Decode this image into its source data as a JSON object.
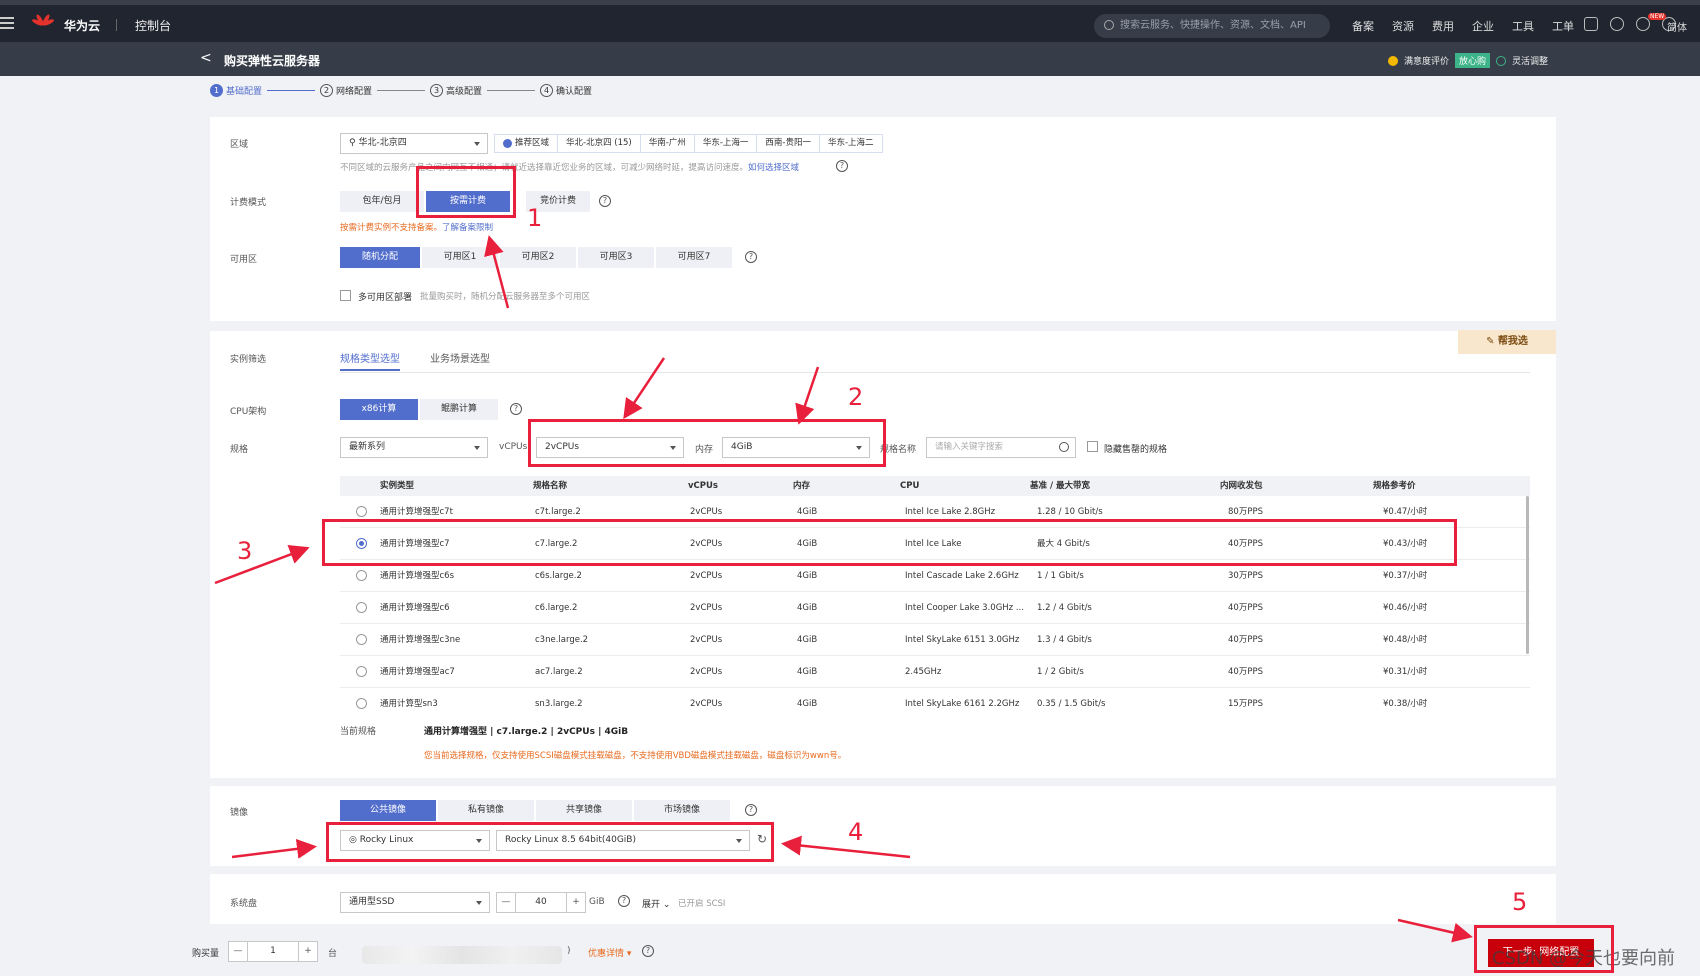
{
  "topbar": {
    "brand": "华为云",
    "console": "控制台",
    "search_placeholder": "搜索云服务、快捷操作、资源、文档、API",
    "links": [
      "备案",
      "资源",
      "费用",
      "企业",
      "工具",
      "工单"
    ],
    "new_badge": "NEW",
    "lang": "简体"
  },
  "subbar": {
    "back": "<",
    "title": "购买弹性云服务器",
    "feedback": "满意度评价",
    "badge": "放心购",
    "flex": "灵活调整"
  },
  "steps": [
    {
      "num": "1",
      "label": "基础配置"
    },
    {
      "num": "2",
      "label": "网络配置"
    },
    {
      "num": "3",
      "label": "高级配置"
    },
    {
      "num": "4",
      "label": "确认配置"
    }
  ],
  "region": {
    "label": "区域",
    "value": "华北-北京四",
    "recommend_label": "推荐区域",
    "options": [
      "华北-北京四 (15)",
      "华南-广州",
      "华东-上海一",
      "西南-贵阳一",
      "华东-上海二"
    ],
    "note": "不同区域的云服务产品之间内网互不相通；请就近选择靠近您业务的区域，可减少网络时延，提高访问速度。",
    "note_link": "如何选择区域"
  },
  "billing": {
    "label": "计费模式",
    "options": [
      "包年/包月",
      "按需计费",
      "竞价计费"
    ],
    "warning": "按需计费实例不支持备案。",
    "warning_link": "了解备案限制"
  },
  "zone": {
    "label": "可用区",
    "options": [
      "随机分配",
      "可用区1",
      "可用区2",
      "可用区3",
      "可用区7"
    ],
    "multi_label": "多可用区部署",
    "multi_note": "批量购买时，随机分配云服务器至多个可用区"
  },
  "instance_filter": {
    "label": "实例筛选",
    "tabs": [
      "规格类型选型",
      "业务场景选型"
    ],
    "helpme": "帮我选"
  },
  "cpu_arch": {
    "label": "CPU架构",
    "options": [
      "x86计算",
      "鲲鹏计算"
    ]
  },
  "spec": {
    "label": "规格",
    "series": "最新系列",
    "vcpus_label": "vCPUs",
    "vcpus": "2vCPUs",
    "mem_label": "内存",
    "mem": "4GiB",
    "name_label": "规格名称",
    "name_placeholder": "请输入关键字搜索",
    "hide_label": "隐藏售罄的规格"
  },
  "table": {
    "headers": [
      "实例类型",
      "规格名称",
      "vCPUs",
      "内存",
      "CPU",
      "基准 / 最大带宽",
      "内网收发包",
      "规格参考价"
    ],
    "rows": [
      {
        "type": "通用计算增强型c7t",
        "name": "c7t.large.2",
        "vcpus": "2vCPUs",
        "mem": "4GiB",
        "cpu": "Intel Ice Lake 2.8GHz",
        "bw": "1.28 / 10 Gbit/s",
        "pps": "80万PPS",
        "price": "¥0.47/小时"
      },
      {
        "type": "通用计算增强型c7",
        "name": "c7.large.2",
        "vcpus": "2vCPUs",
        "mem": "4GiB",
        "cpu": "Intel Ice Lake",
        "bw": "最大 4 Gbit/s",
        "pps": "40万PPS",
        "price": "¥0.43/小时"
      },
      {
        "type": "通用计算增强型c6s",
        "name": "c6s.large.2",
        "vcpus": "2vCPUs",
        "mem": "4GiB",
        "cpu": "Intel Cascade Lake 2.6GHz",
        "bw": "1 / 1 Gbit/s",
        "pps": "30万PPS",
        "price": "¥0.37/小时"
      },
      {
        "type": "通用计算增强型c6",
        "name": "c6.large.2",
        "vcpus": "2vCPUs",
        "mem": "4GiB",
        "cpu": "Intel Cooper Lake 3.0GHz ...",
        "bw": "1.2 / 4 Gbit/s",
        "pps": "40万PPS",
        "price": "¥0.46/小时"
      },
      {
        "type": "通用计算增强型c3ne",
        "name": "c3ne.large.2",
        "vcpus": "2vCPUs",
        "mem": "4GiB",
        "cpu": "Intel SkyLake 6151 3.0GHz",
        "bw": "1.3 / 4 Gbit/s",
        "pps": "40万PPS",
        "price": "¥0.48/小时"
      },
      {
        "type": "通用计算增强型ac7",
        "name": "ac7.large.2",
        "vcpus": "2vCPUs",
        "mem": "4GiB",
        "cpu": "2.45GHz",
        "bw": "1 / 2 Gbit/s",
        "pps": "40万PPS",
        "price": "¥0.31/小时"
      },
      {
        "type": "通用计算型sn3",
        "name": "sn3.large.2",
        "vcpus": "2vCPUs",
        "mem": "4GiB",
        "cpu": "Intel SkyLake 6161 2.2GHz",
        "bw": "0.35 / 1.5 Gbit/s",
        "pps": "15万PPS",
        "price": "¥0.38/小时"
      }
    ]
  },
  "current": {
    "label": "当前规格",
    "value": "通用计算增强型 | c7.large.2 | 2vCPUs | 4GiB",
    "warning": "您当前选择规格，仅支持使用SCSI磁盘模式挂载磁盘，不支持使用VBD磁盘模式挂载磁盘，磁盘标识为wwn号。"
  },
  "image": {
    "label": "镜像",
    "tabs": [
      "公共镜像",
      "私有镜像",
      "共享镜像",
      "市场镜像"
    ],
    "os": "Rocky Linux",
    "version": "Rocky Linux 8.5 64bit(40GiB)"
  },
  "disk": {
    "label": "系统盘",
    "type": "通用型SSD",
    "minus": "—",
    "size": "40",
    "plus": "+",
    "unit": "GiB",
    "expand": "展开",
    "scsi": "已开启 SCSI"
  },
  "footer": {
    "qty_label": "购买量",
    "qty": "1",
    "unit": "台",
    "paren": ")",
    "detail_link": "优惠详情",
    "next": "下一步: 网络配置",
    "watermark": "CSDN @今天也要向前"
  },
  "annotations": [
    "1",
    "2",
    "3",
    "4",
    "5"
  ],
  "colors": {
    "accent": "#526ecc",
    "annotation": "#e8203c",
    "brand_red": "#c7000b",
    "warning": "#e86a1f"
  }
}
